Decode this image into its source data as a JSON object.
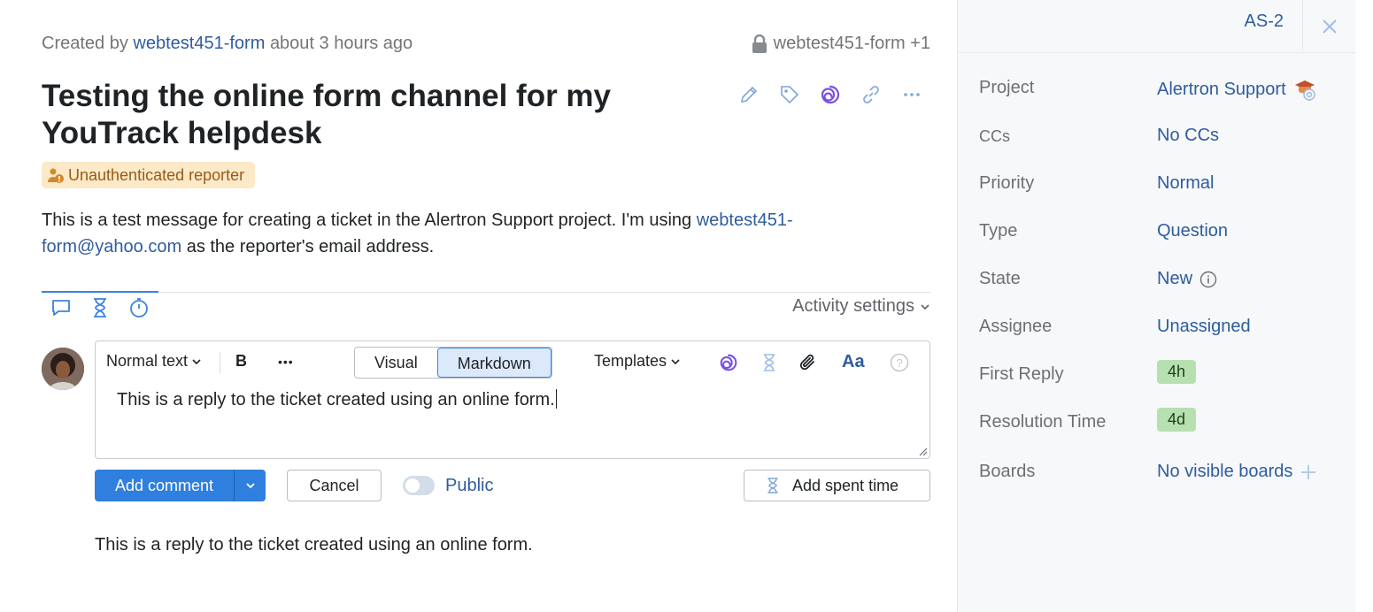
{
  "header": {
    "created_prefix": "Created by",
    "created_user": "webtest451-form",
    "created_time": "about 3 hours ago",
    "visibility": "webtest451-form +1"
  },
  "issue": {
    "title": "Testing the online form channel for my YouTrack helpdesk",
    "badge": "Unauthenticated reporter",
    "desc_part1": "This is a test message for creating a ticket in the Alertron Support project. I'm using ",
    "desc_email": "webtest451-form@yahoo.com",
    "desc_part2": " as the reporter's email address."
  },
  "activity": {
    "settings_label": "Activity settings"
  },
  "editor": {
    "text_style": "Normal text",
    "bold": "B",
    "more": "•••",
    "mode_visual": "Visual",
    "mode_markdown": "Markdown",
    "templates": "Templates",
    "font_icon": "Aa",
    "help": "?",
    "content": "This is a reply to the ticket created using an online form."
  },
  "actions": {
    "add_comment": "Add comment",
    "cancel": "Cancel",
    "public": "Public",
    "add_spent_time": "Add spent time"
  },
  "comment": {
    "text": "This is a reply to the ticket created using an online form."
  },
  "sidebar": {
    "issue_id": "AS-2",
    "fields": [
      {
        "label": "Project",
        "value": "Alertron Support"
      },
      {
        "label": "CCs",
        "value": "No CCs"
      },
      {
        "label": "Priority",
        "value": "Normal"
      },
      {
        "label": "Type",
        "value": "Question"
      },
      {
        "label": "State",
        "value": "New"
      },
      {
        "label": "Assignee",
        "value": "Unassigned"
      },
      {
        "label": "First Reply",
        "value": "4h"
      },
      {
        "label": "Resolution Time",
        "value": "4d"
      },
      {
        "label": "Boards",
        "value": "No visible boards"
      }
    ]
  },
  "colors": {
    "accent": "#2f7fde",
    "link": "#2f5c9e",
    "badge_bg": "#fbe9c8",
    "pill_bg": "#b7e0b0"
  }
}
